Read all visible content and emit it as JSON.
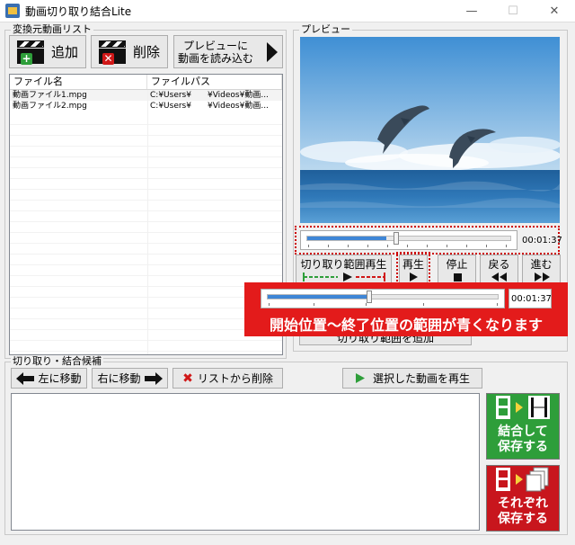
{
  "window": {
    "title": "動画切り取り結合Lite",
    "minimize": "—",
    "maximize": "☐",
    "close": "✕"
  },
  "source_group": {
    "label": "変換元動画リスト",
    "add_label": "追加",
    "delete_label": "削除",
    "load_preview_label_1": "プレビューに",
    "load_preview_label_2": "動画を読み込む",
    "columns": [
      "ファイル名",
      "ファイルパス"
    ],
    "files": [
      {
        "name": "動画ファイル1.mpg",
        "path": "C:¥Users¥　　¥Videos¥動画..."
      },
      {
        "name": "動画ファイル2.mpg",
        "path": "C:¥Users¥　　¥Videos¥動画..."
      }
    ]
  },
  "preview_group": {
    "label": "プレビュー",
    "time": "00:01:37",
    "play_range_label": "切り取り範囲再生",
    "play_label": "再生",
    "stop_label": "停止",
    "back_label": "戻る",
    "forward_label": "進む",
    "hidden_button_label": "切り取り範囲を追加"
  },
  "callout": {
    "time": "00:01:37",
    "text": "開始位置〜終了位置の範囲が青くなります"
  },
  "candidates_group": {
    "label": "切り取り・結合候補",
    "move_left_label": "左に移動",
    "move_right_label": "右に移動",
    "remove_label": "リストから削除",
    "play_selected_label": "選択した動画を再生",
    "merge_save_label_1": "結合して",
    "merge_save_label_2": "保存する",
    "separate_save_label_1": "それぞれ",
    "separate_save_label_2": "保存する"
  },
  "playback": {
    "position_fraction": 0.39,
    "callout_selection_fraction": 0.44
  },
  "colors": {
    "accent_blue": "#3f86d6",
    "callout_red": "#e31b1b",
    "merge_green": "#2e9e3a",
    "separate_red": "#c8161d"
  }
}
